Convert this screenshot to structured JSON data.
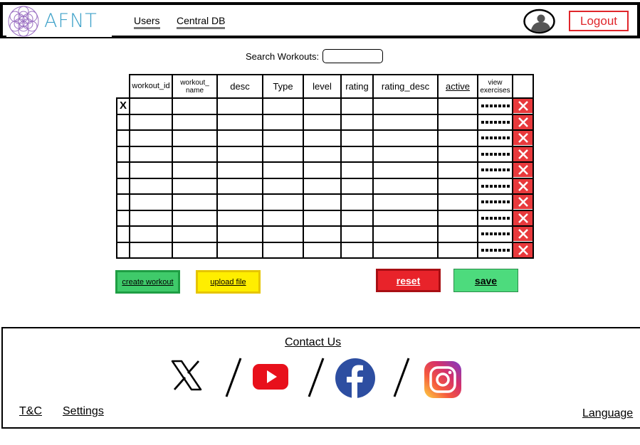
{
  "header": {
    "brand": "AFNT",
    "nav": [
      {
        "label": "Users"
      },
      {
        "label": "Central DB"
      }
    ],
    "logout_label": "Logout"
  },
  "search": {
    "label": "Search Workouts:",
    "value": "",
    "placeholder": ""
  },
  "table": {
    "columns": [
      "workout_id",
      "workout_ name",
      "desc",
      "Type",
      "level",
      "rating",
      "rating_desc",
      "active",
      "view exercises"
    ],
    "row_count": 10,
    "first_row_selection_mark": "X"
  },
  "actions": {
    "create_label": "create workout",
    "upload_label": "upload file",
    "reset_label": "reset",
    "save_label": "save"
  },
  "footer": {
    "contact_label": "Contact Us",
    "social": [
      "x-icon",
      "youtube-icon",
      "facebook-icon",
      "instagram-icon"
    ],
    "tc_label": "T&C",
    "settings_label": "Settings",
    "language_label": "Language"
  },
  "colors": {
    "brand": "#3fa2c9",
    "logo_mark": "#9a6fc2",
    "logout": "#e0262b",
    "create": "#3fca6a",
    "upload": "#ffee00",
    "reset": "#e8232a",
    "save": "#4ddb7d",
    "delete": "#e8393c"
  }
}
